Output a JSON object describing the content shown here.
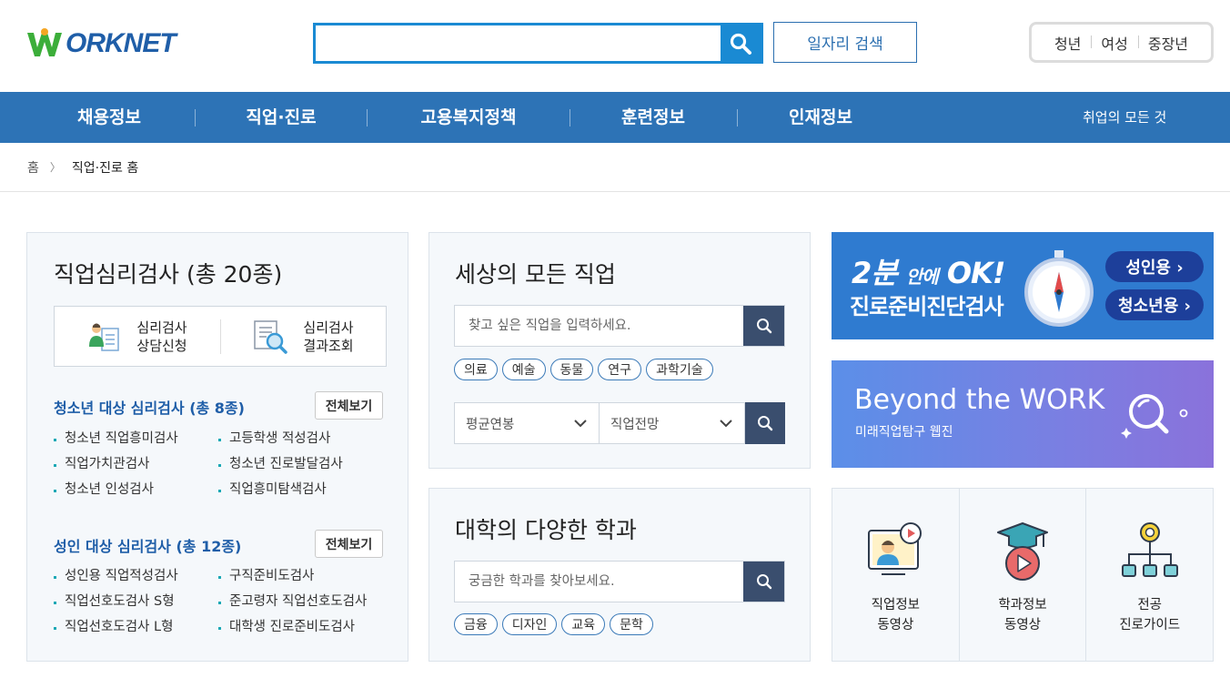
{
  "header": {
    "logo_text": "ORKNET",
    "search_value": "",
    "job_search_label": "일자리 검색",
    "target_links": [
      "청년",
      "여성",
      "중장년"
    ]
  },
  "gnb": {
    "items": [
      "채용정보",
      "직업·진로",
      "고용복지정책",
      "훈련정보",
      "인재정보"
    ],
    "all_link": "취업의 모든 것"
  },
  "breadcrumb": {
    "home": "홈",
    "current": "직업·진로 홈"
  },
  "psych": {
    "title": "직업심리검사 (총 20종)",
    "consult": {
      "line1": "심리검사",
      "line2": "상담신청"
    },
    "result": {
      "line1": "심리검사",
      "line2": "결과조회"
    },
    "youth": {
      "title": "청소년 대상 심리검사 (총 8종)",
      "view_all": "전체보기",
      "items": [
        "청소년 직업흥미검사",
        "고등학생 적성검사",
        "직업가치관검사",
        "청소년 진로발달검사",
        "청소년 인성검사",
        "직업흥미탐색검사"
      ]
    },
    "adult": {
      "title": "성인 대상 심리검사 (총 12종)",
      "view_all": "전체보기",
      "items": [
        "성인용 직업적성검사",
        "구직준비도검사",
        "직업선호도검사 S형",
        "준고령자 직업선호도검사",
        "직업선호도검사 L형",
        "대학생 진로준비도검사"
      ]
    }
  },
  "jobs": {
    "title": "세상의 모든 직업",
    "placeholder": "찾고 싶은 직업을 입력하세요.",
    "tags": [
      "의료",
      "예술",
      "동물",
      "연구",
      "과학기술"
    ],
    "select1": "평균연봉",
    "select2": "직업전망"
  },
  "majors": {
    "title": "대학의 다양한 학과",
    "placeholder": "궁금한 학과를 찾아보세요.",
    "tags": [
      "금융",
      "디자인",
      "교육",
      "문학"
    ]
  },
  "banner1": {
    "big": "2분",
    "small": "안에",
    "ok": "OK!",
    "line2": "진로준비진단검사",
    "pill_adult": "성인용 ›",
    "pill_youth": "청소년용 ›"
  },
  "banner2": {
    "title": "Beyond the WORK",
    "subtitle": "미래직업탐구 웹진"
  },
  "videos": [
    {
      "line1": "직업정보",
      "line2": "동영상"
    },
    {
      "line1": "학과정보",
      "line2": "동영상"
    },
    {
      "line1": "전공",
      "line2": "진로가이드"
    }
  ],
  "colors": {
    "brand_blue": "#2d73b6",
    "search_blue": "#1a8ad3",
    "navy_button": "#3a4e6e",
    "logo_green": "#3cae3a"
  }
}
